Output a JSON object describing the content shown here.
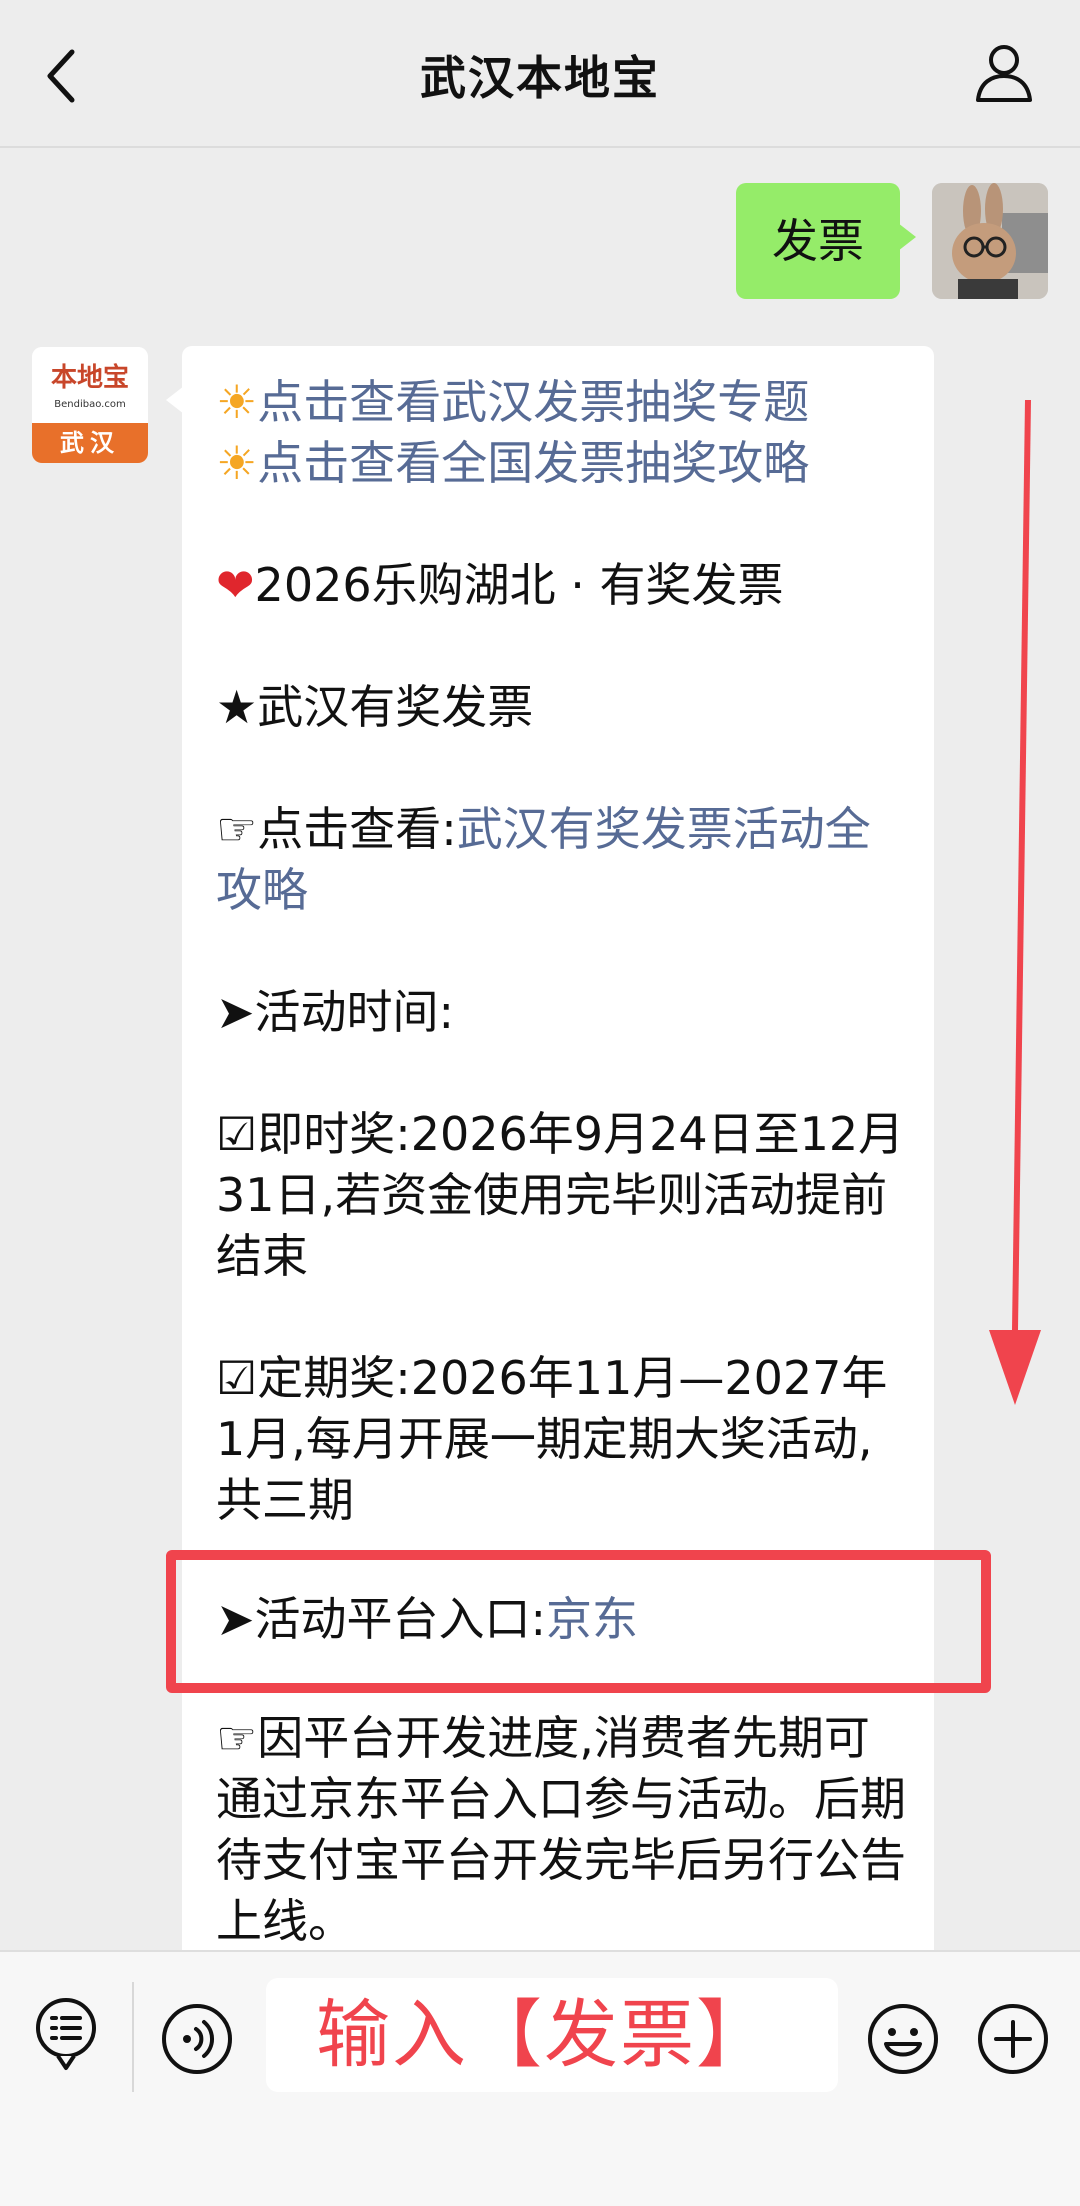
{
  "header": {
    "title": "武汉本地宝",
    "back_icon": "chevron-left-icon",
    "profile_icon": "person-icon"
  },
  "outgoing": {
    "text": "发票"
  },
  "bot": {
    "avatar_brand": "本地宝",
    "avatar_domain": "Bendibao.com",
    "avatar_city": "武汉"
  },
  "message": {
    "link1": "点击查看武汉发票抽奖专题",
    "link2": "点击查看全国发票抽奖攻略",
    "line_promo": "2026乐购湖北 · 有奖发票",
    "line_star": "★武汉有奖发票",
    "line_check_prefix": "☞点击查看:",
    "line_check_link": "武汉有奖发票活动全攻略",
    "line_time_head": "➤活动时间:",
    "line_instant": "☑即时奖:2026年9月24日至12月31日,若资金使用完毕则活动提前结束",
    "line_periodic": "☑定期奖:2026年11月—2027年1月,每月开展一期定期大奖活动,共三期",
    "line_platform_prefix": "➤活动平台入口:",
    "line_platform_link": "京东",
    "line_note": "☞因平台开发进度,消费者先期可通过京东平台入口参与活动。后期待支付宝平台开发完毕后另行公告上线。"
  },
  "input_bar": {
    "hint": "输入【发票】",
    "icons": [
      "menu-icon",
      "voice-icon",
      "emoji-icon",
      "plus-icon"
    ]
  },
  "colors": {
    "bg": "#ededed",
    "out_bubble": "#95ec69",
    "link": "#576b95",
    "annotation_red": "#f0444d",
    "avatar_orange": "#e8702a"
  }
}
